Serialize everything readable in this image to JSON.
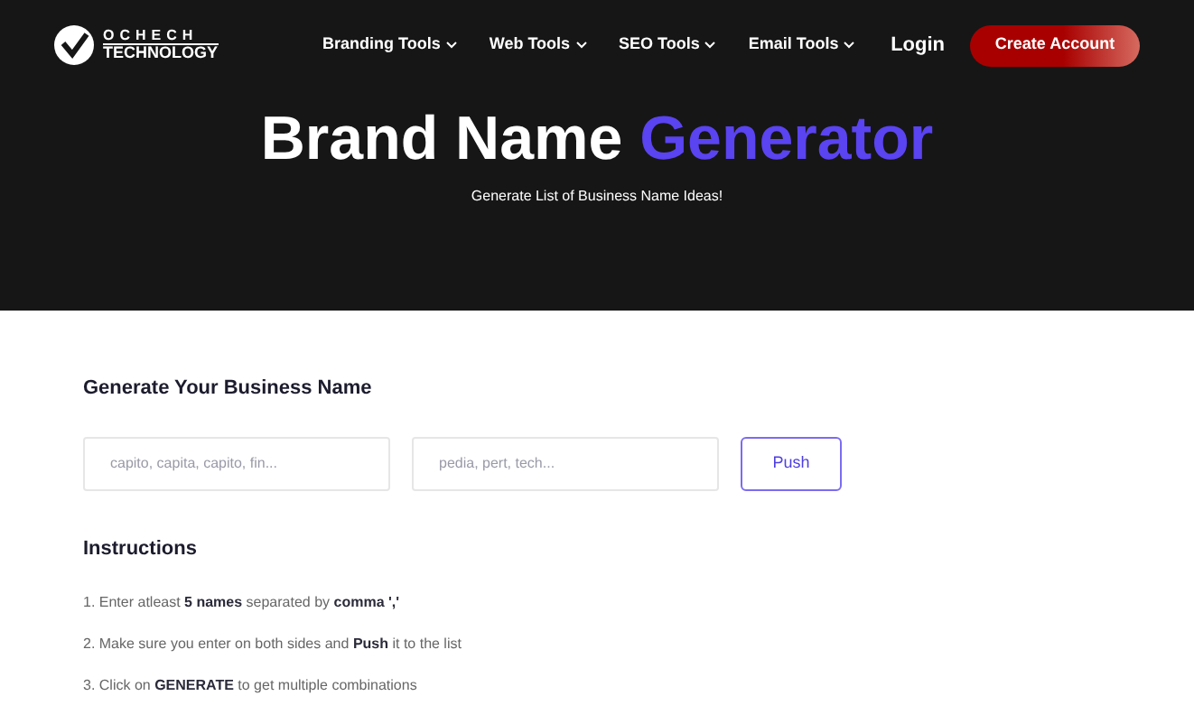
{
  "logo": {
    "top": "OCHECH",
    "bottom": "TECHNOLOGY"
  },
  "nav": [
    {
      "label": "Branding Tools",
      "has_menu": true
    },
    {
      "label": "Web Tools",
      "has_menu": true
    },
    {
      "label": "SEO Tools",
      "has_menu": true
    },
    {
      "label": "Email Tools",
      "has_menu": true
    }
  ],
  "login": "Login",
  "create_account": "Create Account",
  "hero": {
    "title": "Brand Name",
    "title_accent": "Generator",
    "subtitle": "Generate List of Business Name Ideas!"
  },
  "form": {
    "heading": "Generate Your Business Name",
    "left": {
      "placeholder": "capito, capita, capito, fin..."
    },
    "right": {
      "placeholder": "pedia, pert, tech..."
    },
    "button": "Push"
  },
  "instructions": {
    "heading": "Instructions",
    "steps": [
      "1. Enter atleast **5 names** separated by **comma ','**",
      "2. Make sure you enter on both sides and **Push** it to the list",
      "3. Click on **GENERATE** to get multiple combinations"
    ]
  }
}
